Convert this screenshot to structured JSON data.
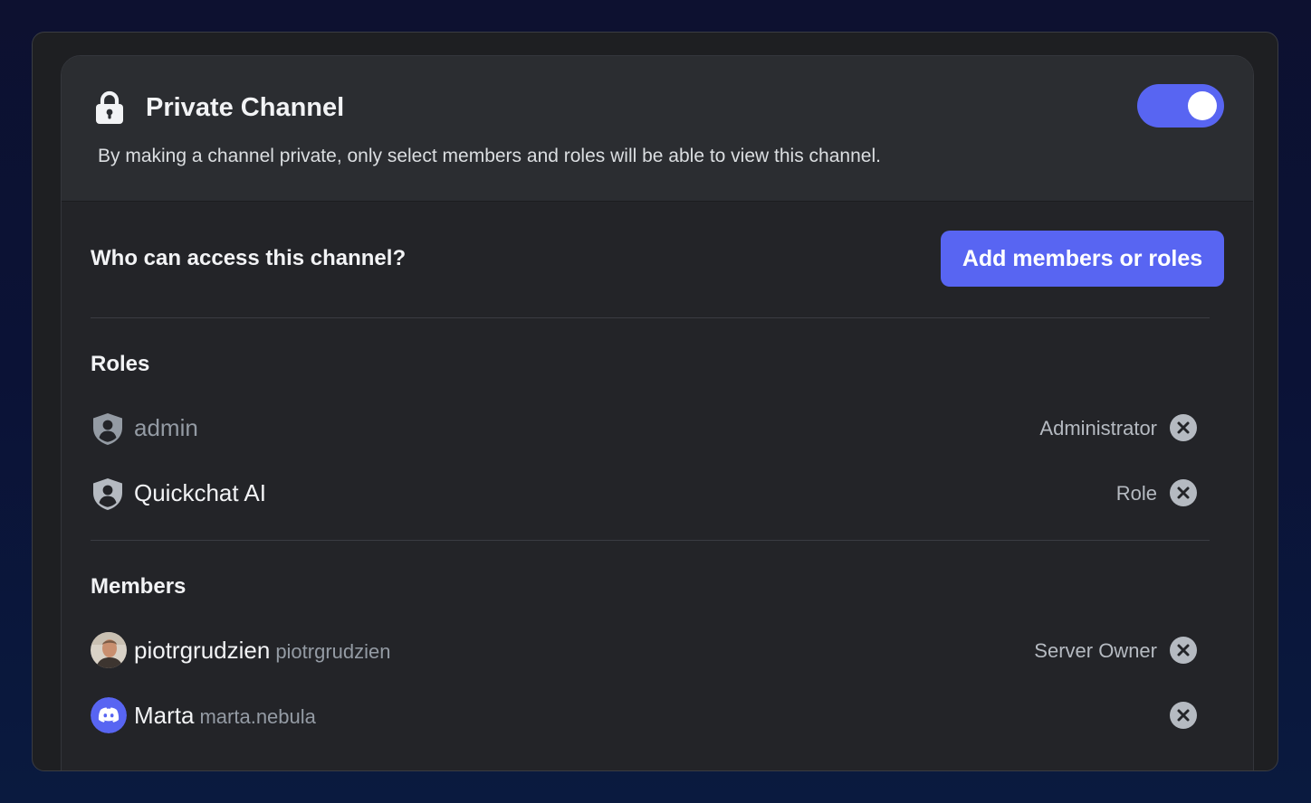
{
  "header": {
    "lock_icon": "lock-icon",
    "title": "Private Channel",
    "description": "By making a channel private, only select members and roles will be able to view this channel.",
    "private_toggle_on": true
  },
  "access": {
    "heading": "Who can access this channel?",
    "add_button_label": "Add members or roles"
  },
  "roles": {
    "title": "Roles",
    "items": [
      {
        "name": "admin",
        "tag": "Administrator",
        "icon": "role-shield-icon",
        "muted": true
      },
      {
        "name": "Quickchat AI",
        "tag": "Role",
        "icon": "role-shield-icon",
        "muted": false
      }
    ]
  },
  "members": {
    "title": "Members",
    "items": [
      {
        "name": "piotrgrudzien",
        "username": "piotrgrudzien",
        "tag": "Server Owner",
        "icon": "user-photo-avatar"
      },
      {
        "name": "Marta",
        "username": "marta.nebula",
        "tag": "",
        "icon": "discord-avatar-icon"
      }
    ]
  },
  "colors": {
    "accent": "#5865f2",
    "panel": "#232428",
    "header": "#2b2d31",
    "text_muted": "#949ba4"
  }
}
